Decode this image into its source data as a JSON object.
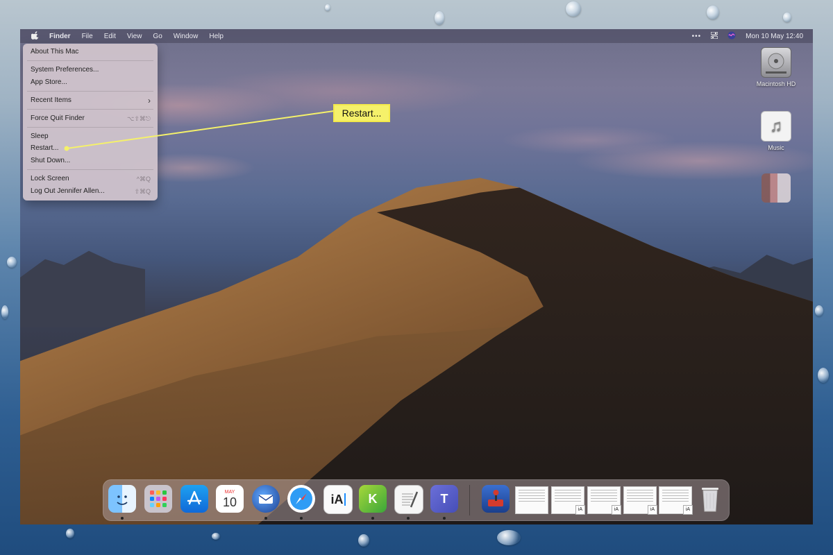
{
  "menubar": {
    "apple_icon": "apple-logo-icon",
    "items": [
      "Finder",
      "File",
      "Edit",
      "View",
      "Go",
      "Window",
      "Help"
    ],
    "status_icons": [
      "more-icon",
      "control-center-icon",
      "siri-icon"
    ],
    "clock": "Mon 10 May  12:40"
  },
  "apple_menu": {
    "about": "About This Mac",
    "system_prefs": "System Preferences...",
    "app_store": "App Store...",
    "recent_items": "Recent Items",
    "recent_items_arrow": "›",
    "force_quit": "Force Quit Finder",
    "force_quit_shortcut": "⌥⇧⌘⎋",
    "sleep": "Sleep",
    "restart": "Restart...",
    "shut_down": "Shut Down...",
    "lock_screen": "Lock Screen",
    "lock_screen_shortcut": "^⌘Q",
    "log_out": "Log Out Jennifer Allen...",
    "log_out_shortcut": "⇧⌘Q"
  },
  "callout": {
    "label": "Restart...",
    "color": "#f5f16a"
  },
  "desktop": {
    "icons": [
      {
        "label": "Macintosh HD",
        "icon": "hard-drive-icon"
      },
      {
        "label": "Music",
        "icon": "music-icon"
      },
      {
        "label": "",
        "icon": "blurred-image-icon"
      }
    ]
  },
  "dock": {
    "apps": [
      {
        "name": "Finder",
        "icon": "finder-icon"
      },
      {
        "name": "Launchpad",
        "icon": "launchpad-icon"
      },
      {
        "name": "App Store",
        "icon": "app-store-icon"
      },
      {
        "name": "Calendar",
        "icon": "calendar-icon",
        "month": "MAY",
        "day": "10"
      },
      {
        "name": "Thunderbird",
        "icon": "thunderbird-icon"
      },
      {
        "name": "Safari",
        "icon": "safari-icon"
      },
      {
        "name": "iA Writer",
        "icon": "ia-writer-icon",
        "text": "iA"
      },
      {
        "name": "Kindle",
        "icon": "kindle-icon",
        "text": "K"
      },
      {
        "name": "TextEdit",
        "icon": "textedit-icon"
      },
      {
        "name": "Teams",
        "icon": "teams-icon",
        "text": "T"
      },
      {
        "name": "Joystick App",
        "icon": "joystick-icon"
      }
    ],
    "documents_badge": "iA",
    "trash_icon": "trash-icon"
  }
}
